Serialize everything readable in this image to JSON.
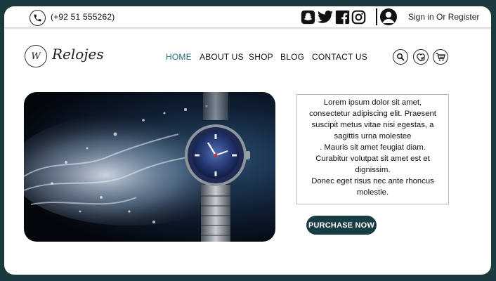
{
  "topbar": {
    "phone": "(+92 51 555262)",
    "sign_in": "Sign in Or Register",
    "social_icons": [
      "snapchat-icon",
      "twitter-icon",
      "facebook-icon",
      "instagram-icon"
    ]
  },
  "brand": {
    "logo_mark": "W",
    "name": "Relojes"
  },
  "nav": {
    "items": [
      "HOME",
      "ABOUT US",
      "SHOP",
      "BLOG",
      "CONTACT US"
    ],
    "active_index": 0
  },
  "icons": {
    "actions": [
      "search-icon",
      "wishlist-icon",
      "cart-icon"
    ]
  },
  "content": {
    "lines": [
      "Lorem ipsum dolor sit amet,",
      "consectetur adipiscing elit. Praesent",
      "suscipit metus vitae nisi egestas, a",
      "sagittis urna molestee",
      ". Mauris sit amet feugiat diam.",
      "Curabitur volutpat sit amet est et",
      "dignissim.",
      "Donec eget risus nec ante rhoncus",
      "molestie."
    ],
    "button": "PURCHASE NOW"
  },
  "colors": {
    "accent": "#1f6f7c",
    "button_bg": "#173c44",
    "page_bg": "#1b3a40"
  }
}
